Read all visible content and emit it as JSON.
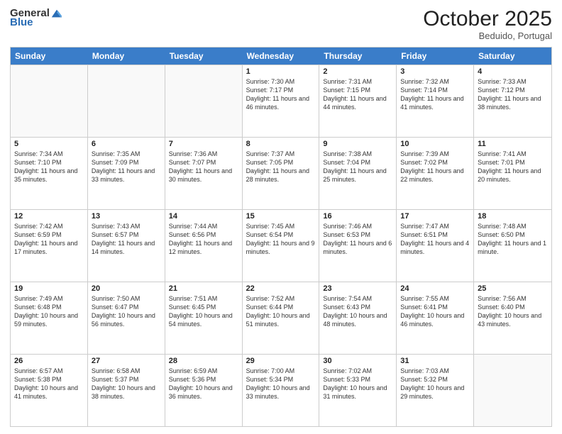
{
  "header": {
    "logo_general": "General",
    "logo_blue": "Blue",
    "month_title": "October 2025",
    "location": "Beduido, Portugal"
  },
  "weekdays": [
    "Sunday",
    "Monday",
    "Tuesday",
    "Wednesday",
    "Thursday",
    "Friday",
    "Saturday"
  ],
  "rows": [
    [
      {
        "day": "",
        "empty": true
      },
      {
        "day": "",
        "empty": true
      },
      {
        "day": "",
        "empty": true
      },
      {
        "day": "1",
        "sunrise": "7:30 AM",
        "sunset": "7:17 PM",
        "daylight": "11 hours and 46 minutes."
      },
      {
        "day": "2",
        "sunrise": "7:31 AM",
        "sunset": "7:15 PM",
        "daylight": "11 hours and 44 minutes."
      },
      {
        "day": "3",
        "sunrise": "7:32 AM",
        "sunset": "7:14 PM",
        "daylight": "11 hours and 41 minutes."
      },
      {
        "day": "4",
        "sunrise": "7:33 AM",
        "sunset": "7:12 PM",
        "daylight": "11 hours and 38 minutes."
      }
    ],
    [
      {
        "day": "5",
        "sunrise": "7:34 AM",
        "sunset": "7:10 PM",
        "daylight": "11 hours and 35 minutes."
      },
      {
        "day": "6",
        "sunrise": "7:35 AM",
        "sunset": "7:09 PM",
        "daylight": "11 hours and 33 minutes."
      },
      {
        "day": "7",
        "sunrise": "7:36 AM",
        "sunset": "7:07 PM",
        "daylight": "11 hours and 30 minutes."
      },
      {
        "day": "8",
        "sunrise": "7:37 AM",
        "sunset": "7:05 PM",
        "daylight": "11 hours and 28 minutes."
      },
      {
        "day": "9",
        "sunrise": "7:38 AM",
        "sunset": "7:04 PM",
        "daylight": "11 hours and 25 minutes."
      },
      {
        "day": "10",
        "sunrise": "7:39 AM",
        "sunset": "7:02 PM",
        "daylight": "11 hours and 22 minutes."
      },
      {
        "day": "11",
        "sunrise": "7:41 AM",
        "sunset": "7:01 PM",
        "daylight": "11 hours and 20 minutes."
      }
    ],
    [
      {
        "day": "12",
        "sunrise": "7:42 AM",
        "sunset": "6:59 PM",
        "daylight": "11 hours and 17 minutes."
      },
      {
        "day": "13",
        "sunrise": "7:43 AM",
        "sunset": "6:57 PM",
        "daylight": "11 hours and 14 minutes."
      },
      {
        "day": "14",
        "sunrise": "7:44 AM",
        "sunset": "6:56 PM",
        "daylight": "11 hours and 12 minutes."
      },
      {
        "day": "15",
        "sunrise": "7:45 AM",
        "sunset": "6:54 PM",
        "daylight": "11 hours and 9 minutes."
      },
      {
        "day": "16",
        "sunrise": "7:46 AM",
        "sunset": "6:53 PM",
        "daylight": "11 hours and 6 minutes."
      },
      {
        "day": "17",
        "sunrise": "7:47 AM",
        "sunset": "6:51 PM",
        "daylight": "11 hours and 4 minutes."
      },
      {
        "day": "18",
        "sunrise": "7:48 AM",
        "sunset": "6:50 PM",
        "daylight": "11 hours and 1 minute."
      }
    ],
    [
      {
        "day": "19",
        "sunrise": "7:49 AM",
        "sunset": "6:48 PM",
        "daylight": "10 hours and 59 minutes."
      },
      {
        "day": "20",
        "sunrise": "7:50 AM",
        "sunset": "6:47 PM",
        "daylight": "10 hours and 56 minutes."
      },
      {
        "day": "21",
        "sunrise": "7:51 AM",
        "sunset": "6:45 PM",
        "daylight": "10 hours and 54 minutes."
      },
      {
        "day": "22",
        "sunrise": "7:52 AM",
        "sunset": "6:44 PM",
        "daylight": "10 hours and 51 minutes."
      },
      {
        "day": "23",
        "sunrise": "7:54 AM",
        "sunset": "6:43 PM",
        "daylight": "10 hours and 48 minutes."
      },
      {
        "day": "24",
        "sunrise": "7:55 AM",
        "sunset": "6:41 PM",
        "daylight": "10 hours and 46 minutes."
      },
      {
        "day": "25",
        "sunrise": "7:56 AM",
        "sunset": "6:40 PM",
        "daylight": "10 hours and 43 minutes."
      }
    ],
    [
      {
        "day": "26",
        "sunrise": "6:57 AM",
        "sunset": "5:38 PM",
        "daylight": "10 hours and 41 minutes."
      },
      {
        "day": "27",
        "sunrise": "6:58 AM",
        "sunset": "5:37 PM",
        "daylight": "10 hours and 38 minutes."
      },
      {
        "day": "28",
        "sunrise": "6:59 AM",
        "sunset": "5:36 PM",
        "daylight": "10 hours and 36 minutes."
      },
      {
        "day": "29",
        "sunrise": "7:00 AM",
        "sunset": "5:34 PM",
        "daylight": "10 hours and 33 minutes."
      },
      {
        "day": "30",
        "sunrise": "7:02 AM",
        "sunset": "5:33 PM",
        "daylight": "10 hours and 31 minutes."
      },
      {
        "day": "31",
        "sunrise": "7:03 AM",
        "sunset": "5:32 PM",
        "daylight": "10 hours and 29 minutes."
      },
      {
        "day": "",
        "empty": true
      }
    ]
  ],
  "labels": {
    "sunrise_prefix": "Sunrise: ",
    "sunset_prefix": "Sunset: ",
    "daylight_prefix": "Daylight: "
  }
}
